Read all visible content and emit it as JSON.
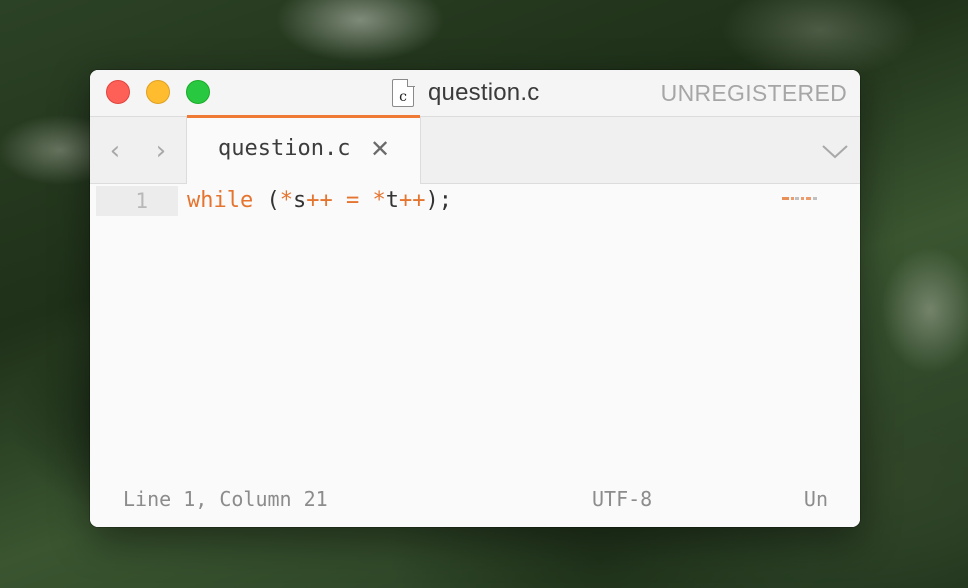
{
  "window": {
    "title": "question.c",
    "file_icon_letter": "c",
    "registration": "UNREGISTERED"
  },
  "tabs": [
    {
      "label": "question.c",
      "active": true,
      "close_icon": "close-icon"
    }
  ],
  "nav": {
    "back_icon": "chevron-left-icon",
    "forward_icon": "chevron-right-icon",
    "dropdown_icon": "chevron-down-icon"
  },
  "editor": {
    "lines": [
      {
        "number": "1",
        "tokens": [
          {
            "type": "kw",
            "text": "while"
          },
          {
            "type": "punc",
            "text": " ("
          },
          {
            "type": "op",
            "text": "*"
          },
          {
            "type": "id",
            "text": "s"
          },
          {
            "type": "op",
            "text": "++"
          },
          {
            "type": "punc",
            "text": " "
          },
          {
            "type": "op",
            "text": "="
          },
          {
            "type": "punc",
            "text": " "
          },
          {
            "type": "op",
            "text": "*"
          },
          {
            "type": "id",
            "text": "t"
          },
          {
            "type": "op",
            "text": "++"
          },
          {
            "type": "punc",
            "text": ");"
          }
        ]
      }
    ]
  },
  "status": {
    "position": "Line 1, Column 21",
    "encoding": "UTF-8",
    "syntax": "Un"
  },
  "colors": {
    "accent": "#ee7a36",
    "keyword": "#e5742f",
    "close_button": "#fe5f57",
    "minimize_button": "#febc2e",
    "maximize_button": "#28c840"
  }
}
